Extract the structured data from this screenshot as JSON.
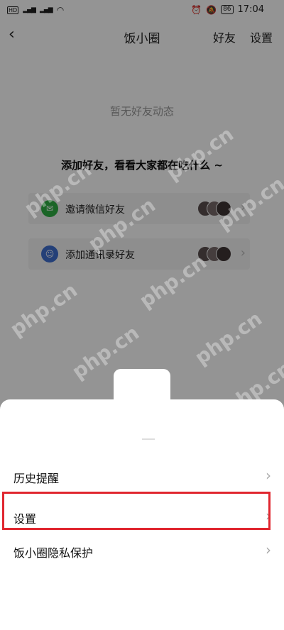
{
  "status_bar": {
    "hd": "HD",
    "signal1": "⁴⁶",
    "signal2": "⁴⁶",
    "battery": "86",
    "time": "17:04"
  },
  "nav": {
    "title": "饭小圈",
    "friends_label": "好友",
    "settings_label": "设置"
  },
  "main": {
    "empty_text": "暂无好友动态",
    "prompt_text": "添加好友，看看大家都在吃什么 ~",
    "rows": [
      {
        "label": "邀请微信好友",
        "icon": "wechat-icon"
      },
      {
        "label": "添加通讯录好友",
        "icon": "contacts-icon"
      }
    ]
  },
  "watermark": "php.cn",
  "sheet": {
    "items": [
      {
        "label": "历史提醒"
      },
      {
        "label": "设置"
      },
      {
        "label": "饭小圈隐私保护"
      }
    ],
    "highlight_color": "#e0262f"
  }
}
